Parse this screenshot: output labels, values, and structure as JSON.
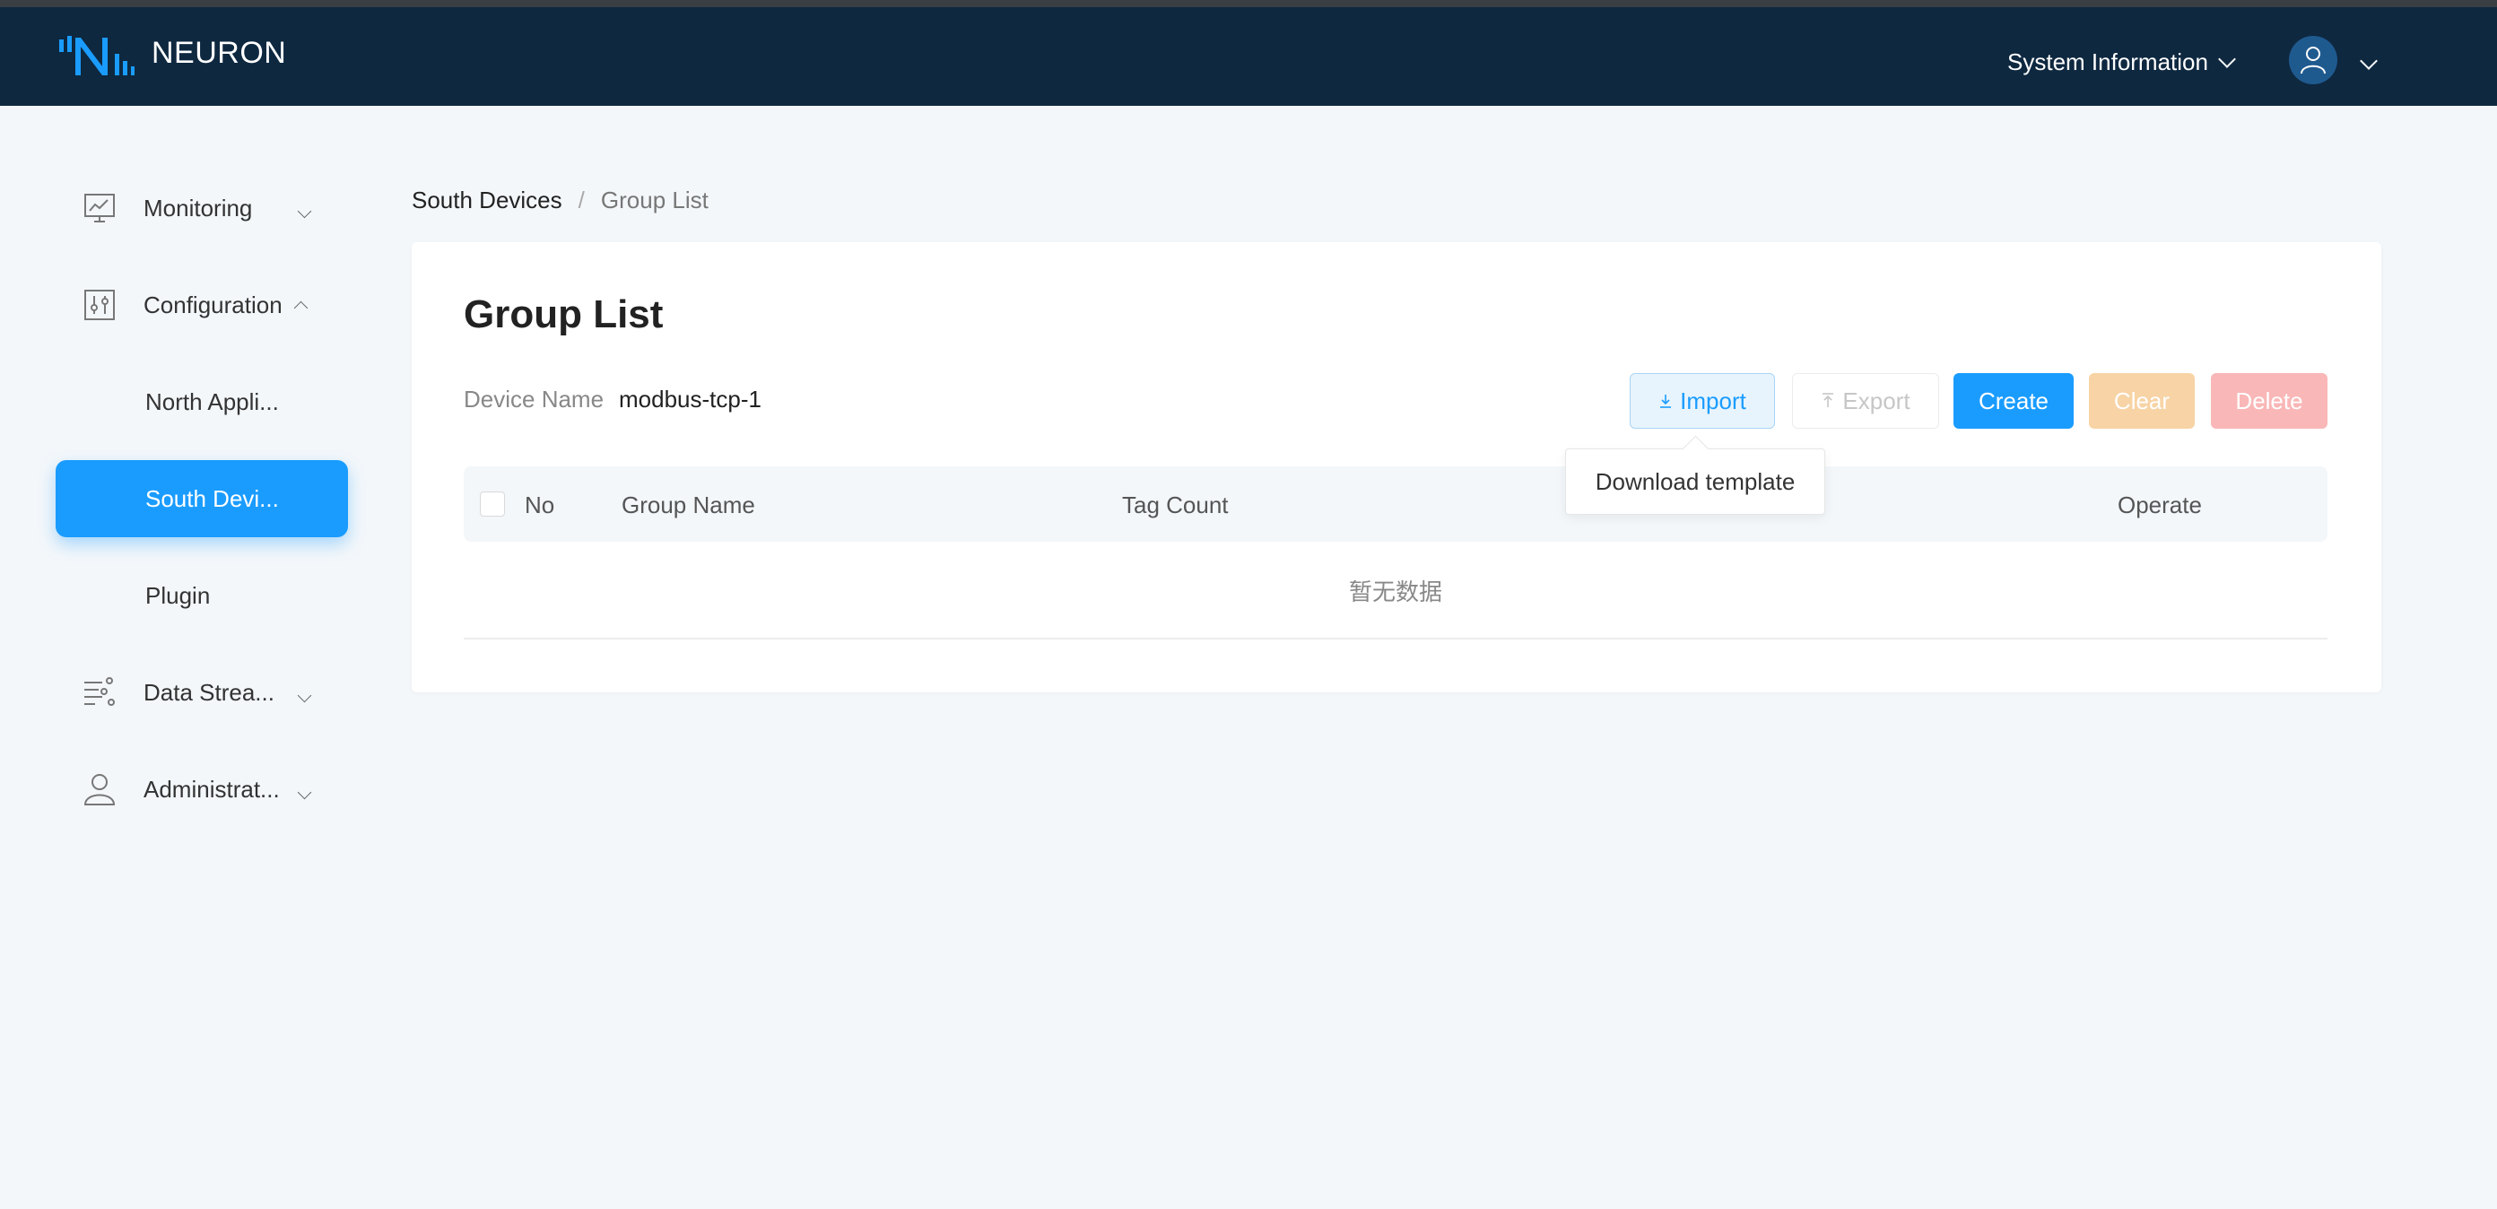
{
  "app": {
    "name": "NEURON"
  },
  "header": {
    "system_info": "System Information"
  },
  "sidebar": {
    "items": [
      {
        "label": "Monitoring",
        "icon": "monitor-chart-icon"
      },
      {
        "label": "Configuration",
        "icon": "config-sliders-icon"
      },
      {
        "label": "North Appli..."
      },
      {
        "label": "South Devi..."
      },
      {
        "label": "Plugin"
      },
      {
        "label": "Data Strea...",
        "icon": "data-stream-icon"
      },
      {
        "label": "Administrat...",
        "icon": "user-icon"
      }
    ]
  },
  "breadcrumb": {
    "parent": "South Devices",
    "separator": "/",
    "current": "Group List"
  },
  "page": {
    "title": "Group List",
    "device_label": "Device Name",
    "device_value": "modbus-tcp-1"
  },
  "toolbar": {
    "import": "Import",
    "export": "Export",
    "create": "Create",
    "clear": "Clear",
    "delete": "Delete",
    "tooltip": "Download template"
  },
  "table": {
    "columns": [
      "No",
      "Group Name",
      "Tag Count",
      "Operate"
    ],
    "empty_text": "暂无数据"
  },
  "colors": {
    "header_bg": "#0e2840",
    "accent": "#1a9cff",
    "clear_bg": "#f7d3a5",
    "delete_bg": "#f9b7b7"
  }
}
